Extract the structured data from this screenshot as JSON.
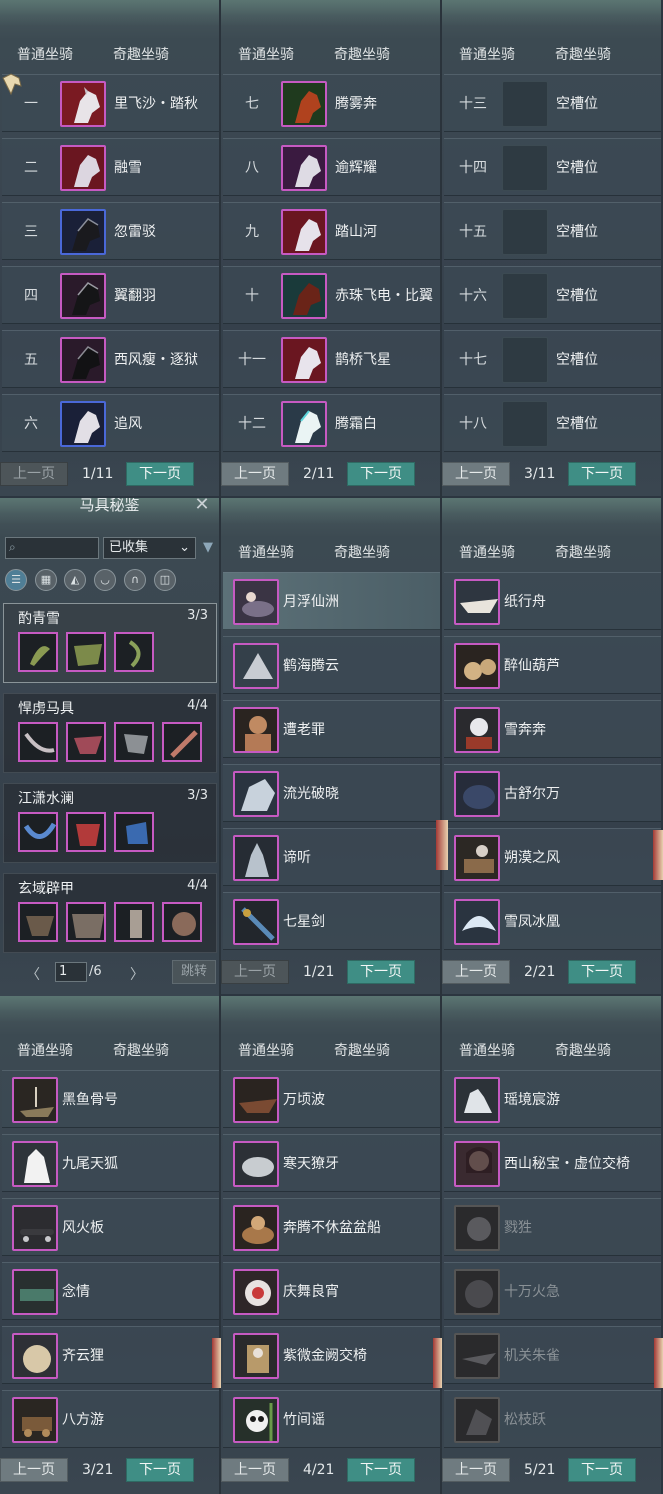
{
  "tabs": [
    "普通坐骑",
    "奇趣坐骑"
  ],
  "prev_label": "上一页",
  "next_label": "下一页",
  "panels": [
    {
      "page": "1/11",
      "rows": [
        {
          "num": "一",
          "name": "里飞沙・踏秋"
        },
        {
          "num": "二",
          "name": "融雪"
        },
        {
          "num": "三",
          "name": "忽雷驳"
        },
        {
          "num": "四",
          "name": "翼翻羽"
        },
        {
          "num": "五",
          "name": "西风瘦・逐狱"
        },
        {
          "num": "六",
          "name": "追风"
        }
      ]
    },
    {
      "page": "2/11",
      "rows": [
        {
          "num": "七",
          "name": "腾雾奔"
        },
        {
          "num": "八",
          "name": "逾辉耀"
        },
        {
          "num": "九",
          "name": "踏山河"
        },
        {
          "num": "十",
          "name": "赤珠飞电・比翼"
        },
        {
          "num": "十一",
          "name": "鹊桥飞星"
        },
        {
          "num": "十二",
          "name": "腾霜白"
        }
      ]
    },
    {
      "page": "3/11",
      "rows": [
        {
          "num": "十三",
          "name": "空槽位"
        },
        {
          "num": "十四",
          "name": "空槽位"
        },
        {
          "num": "十五",
          "name": "空槽位"
        },
        {
          "num": "十六",
          "name": "空槽位"
        },
        {
          "num": "十七",
          "name": "空槽位"
        },
        {
          "num": "十八",
          "name": "空槽位"
        }
      ]
    },
    {
      "page": "1/21",
      "rows": [
        {
          "name": "月浮仙洲"
        },
        {
          "name": "鹤海腾云"
        },
        {
          "name": "遭老罪"
        },
        {
          "name": "流光破晓"
        },
        {
          "name": "谛听"
        },
        {
          "name": "七星剑"
        }
      ]
    },
    {
      "page": "2/21",
      "rows": [
        {
          "name": "纸行舟"
        },
        {
          "name": "醉仙葫芦"
        },
        {
          "name": "雪奔奔"
        },
        {
          "name": "古舒尔万"
        },
        {
          "name": "朔漠之风"
        },
        {
          "name": "雪凤冰凰"
        }
      ]
    },
    {
      "page": "3/21",
      "rows": [
        {
          "name": "黑鱼骨号"
        },
        {
          "name": "九尾天狐"
        },
        {
          "name": "风火板"
        },
        {
          "name": "念情"
        },
        {
          "name": "齐云狸"
        },
        {
          "name": "八方游"
        }
      ]
    },
    {
      "page": "4/21",
      "rows": [
        {
          "name": "万顷波"
        },
        {
          "name": "寒天獠牙"
        },
        {
          "name": "奔腾不休盆盆船"
        },
        {
          "name": "庆舞良宵"
        },
        {
          "name": "紫微金阙交椅"
        },
        {
          "name": "竹间谣"
        }
      ]
    },
    {
      "page": "5/21",
      "rows": [
        {
          "name": "瑶境宸游"
        },
        {
          "name": "西山秘宝・虚位交椅"
        },
        {
          "name": "戮狌"
        },
        {
          "name": "十万火急"
        },
        {
          "name": "机关朱雀"
        },
        {
          "name": "松枝跃"
        }
      ]
    }
  ],
  "sidebar": {
    "title": "马具秘鉴",
    "filter_value": "已收集",
    "groups": [
      {
        "name": "酌青雪",
        "count": "3/3"
      },
      {
        "name": "悍虏马具",
        "count": "4/4"
      },
      {
        "name": "江潇水澜",
        "count": "3/3"
      },
      {
        "name": "玄域辟甲",
        "count": "4/4"
      }
    ],
    "page_value": "1",
    "page_total": "/6",
    "jump_label": "跳转"
  }
}
